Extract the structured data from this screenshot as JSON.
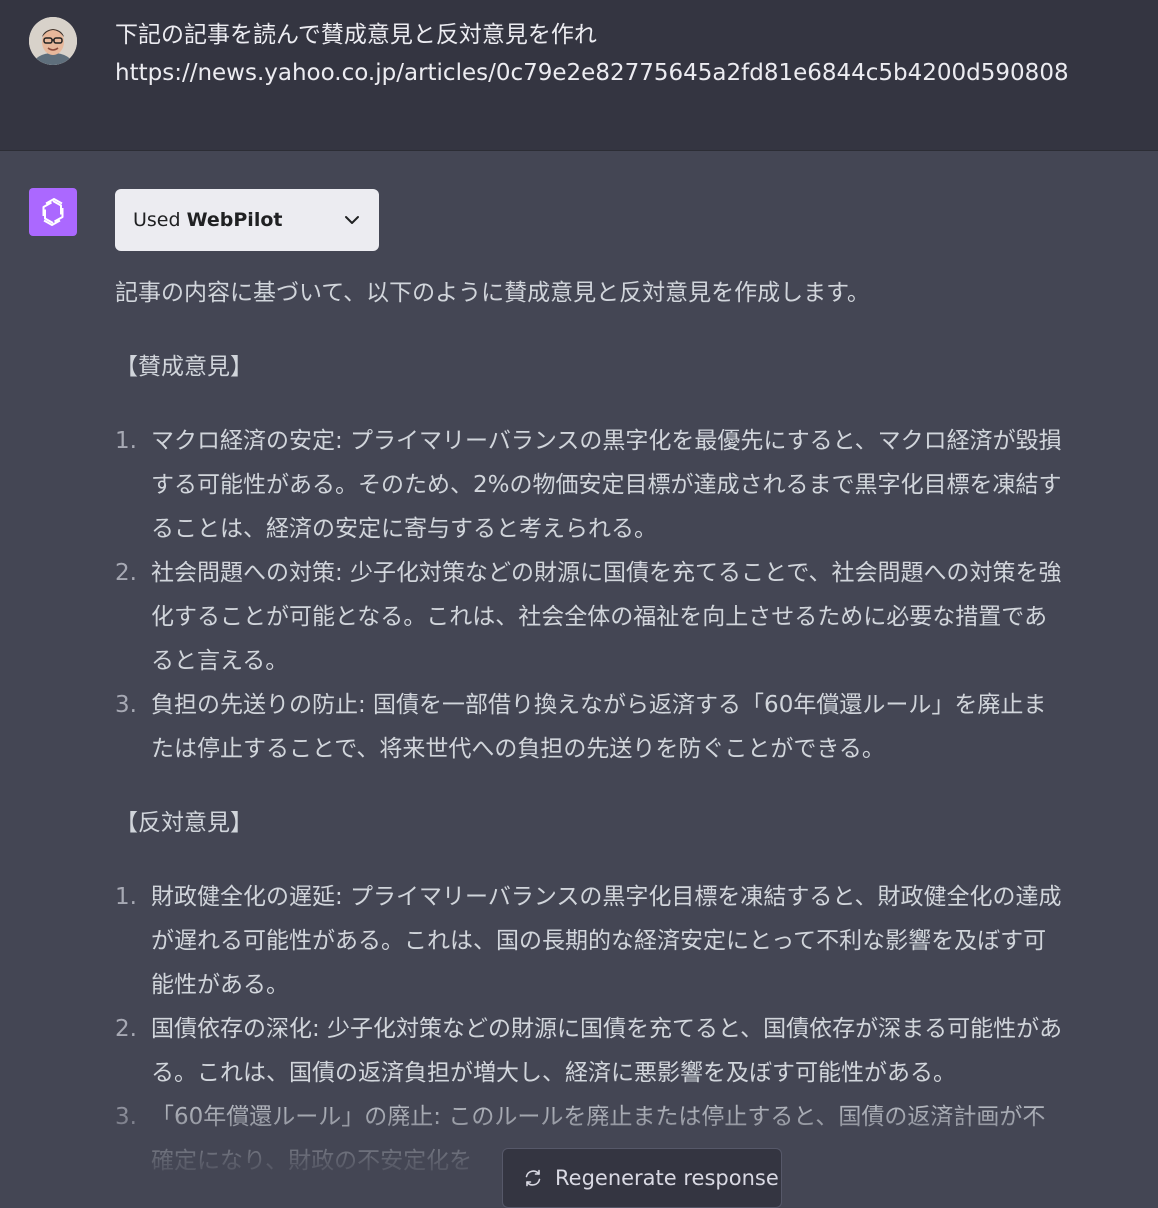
{
  "user_message": {
    "line1": "下記の記事を読んで賛成意見と反対意見を作れ",
    "line2": "https://news.yahoo.co.jp/articles/0c79e2e82775645a2fd81e6844c5b4200d590808"
  },
  "assistant": {
    "plugin": {
      "prefix": "Used",
      "name": "WebPilot",
      "icon": "chevron-down-icon"
    },
    "intro": "記事の内容に基づいて、以下のように賛成意見と反対意見を作成します。",
    "pro_heading": "【賛成意見】",
    "pro_items": [
      {
        "num": "1.",
        "lines": [
          "マクロ経済の安定: プライマリーバランスの黒字化を最優先にすると、マクロ経済が毀損",
          "する可能性がある。そのため、2%の物価安定目標が達成されるまで黒字化目標を凍結す",
          "ることは、経済の安定に寄与すると考えられる。"
        ]
      },
      {
        "num": "2.",
        "lines": [
          "社会問題への対策: 少子化対策などの財源に国債を充てることで、社会問題への対策を強",
          "化することが可能となる。これは、社会全体の福祉を向上させるために必要な措置であ",
          "ると言える。"
        ]
      },
      {
        "num": "3.",
        "lines": [
          "負担の先送りの防止: 国債を一部借り換えながら返済する「60年償還ルール」を廃止ま",
          "たは停止することで、将来世代への負担の先送りを防ぐことができる。"
        ]
      }
    ],
    "con_heading": "【反対意見】",
    "con_items": [
      {
        "num": "1.",
        "lines": [
          "財政健全化の遅延: プライマリーバランスの黒字化目標を凍結すると、財政健全化の達成",
          "が遅れる可能性がある。これは、国の長期的な経済安定にとって不利な影響を及ぼす可",
          "能性がある。"
        ]
      },
      {
        "num": "2.",
        "lines": [
          "国債依存の深化: 少子化対策などの財源に国債を充てると、国債依存が深まる可能性があ",
          "る。これは、国債の返済負担が増大し、経済に悪影響を及ぼす可能性がある。"
        ]
      },
      {
        "num": "3.",
        "lines": [
          "「60年償還ルール」の廃止: このルールを廃止または停止すると、国債の返済計画が不",
          "確定になり、財政の不安定化を"
        ]
      }
    ]
  },
  "regenerate_button": {
    "label": "Regenerate response",
    "icon": "refresh-icon"
  },
  "colors": {
    "user_bg": "#343541",
    "assistant_bg": "#444654",
    "gpt_avatar": "#ab68ff"
  }
}
